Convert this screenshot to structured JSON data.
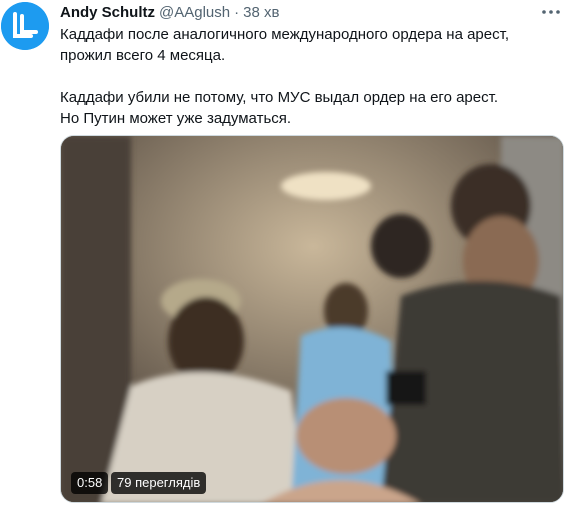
{
  "tweet": {
    "author_name": "Andy Schultz",
    "handle": "@AAglush",
    "separator": "·",
    "time": "38 хв",
    "text_line1": "Каддафи после аналогичного международного ордера на арест,",
    "text_line2": "прожил всего 4 месяца.",
    "text_line3": "Каддафи убили не потому, что МУС выдал ордер на его арест.",
    "text_line4": "Но Путин может уже задуматься."
  },
  "media": {
    "duration": "0:58",
    "views": "79 переглядів"
  },
  "icons": {
    "avatar": "avatar-logo",
    "more": "more-options-icon"
  },
  "colors": {
    "text": "#0f1419",
    "secondary": "#536471",
    "avatar_bg": "#1d9bf0"
  }
}
